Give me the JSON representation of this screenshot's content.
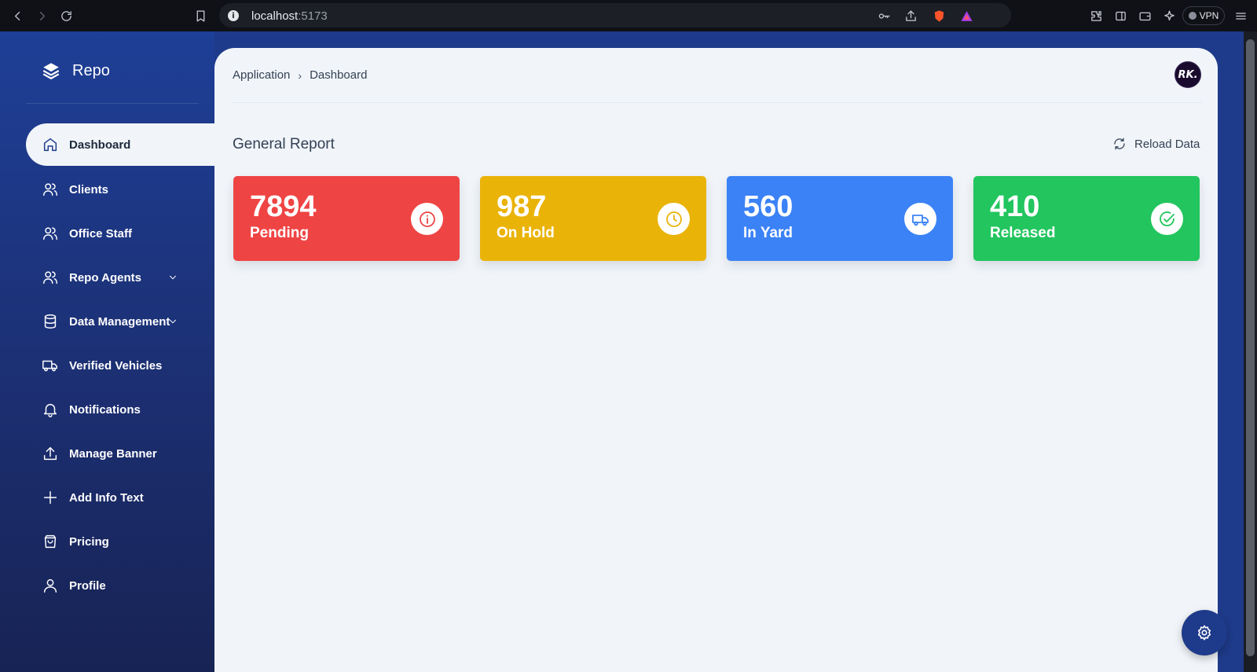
{
  "browser": {
    "url_host": "localhost",
    "url_port": ":5173",
    "vpn_label": "VPN"
  },
  "sidebar": {
    "brand": "Repo",
    "items": [
      {
        "label": "Dashboard",
        "icon": "home-icon",
        "active": true
      },
      {
        "label": "Clients",
        "icon": "users-icon"
      },
      {
        "label": "Office Staff",
        "icon": "users-icon"
      },
      {
        "label": "Repo Agents",
        "icon": "users-icon",
        "has_submenu": true
      },
      {
        "label": "Data Management",
        "icon": "database-icon",
        "has_submenu": true
      },
      {
        "label": "Verified Vehicles",
        "icon": "truck-icon"
      },
      {
        "label": "Notifications",
        "icon": "bell-icon"
      },
      {
        "label": "Manage Banner",
        "icon": "upload-icon"
      },
      {
        "label": "Add Info Text",
        "icon": "plus-icon"
      },
      {
        "label": "Pricing",
        "icon": "shopping-bag-icon"
      },
      {
        "label": "Profile",
        "icon": "user-icon"
      }
    ]
  },
  "header": {
    "breadcrumb_root": "Application",
    "breadcrumb_current": "Dashboard",
    "avatar_initials": "RK."
  },
  "report": {
    "title": "General Report",
    "reload_label": "Reload Data",
    "cards": [
      {
        "value": "7894",
        "label": "Pending",
        "color": "#ef4444",
        "icon": "info-icon"
      },
      {
        "value": "987",
        "label": "On Hold",
        "color": "#eab308",
        "icon": "clock-icon"
      },
      {
        "value": "560",
        "label": "In Yard",
        "color": "#3b82f6",
        "icon": "truck-icon"
      },
      {
        "value": "410",
        "label": "Released",
        "color": "#22c55e",
        "icon": "check-circle-icon"
      }
    ]
  }
}
